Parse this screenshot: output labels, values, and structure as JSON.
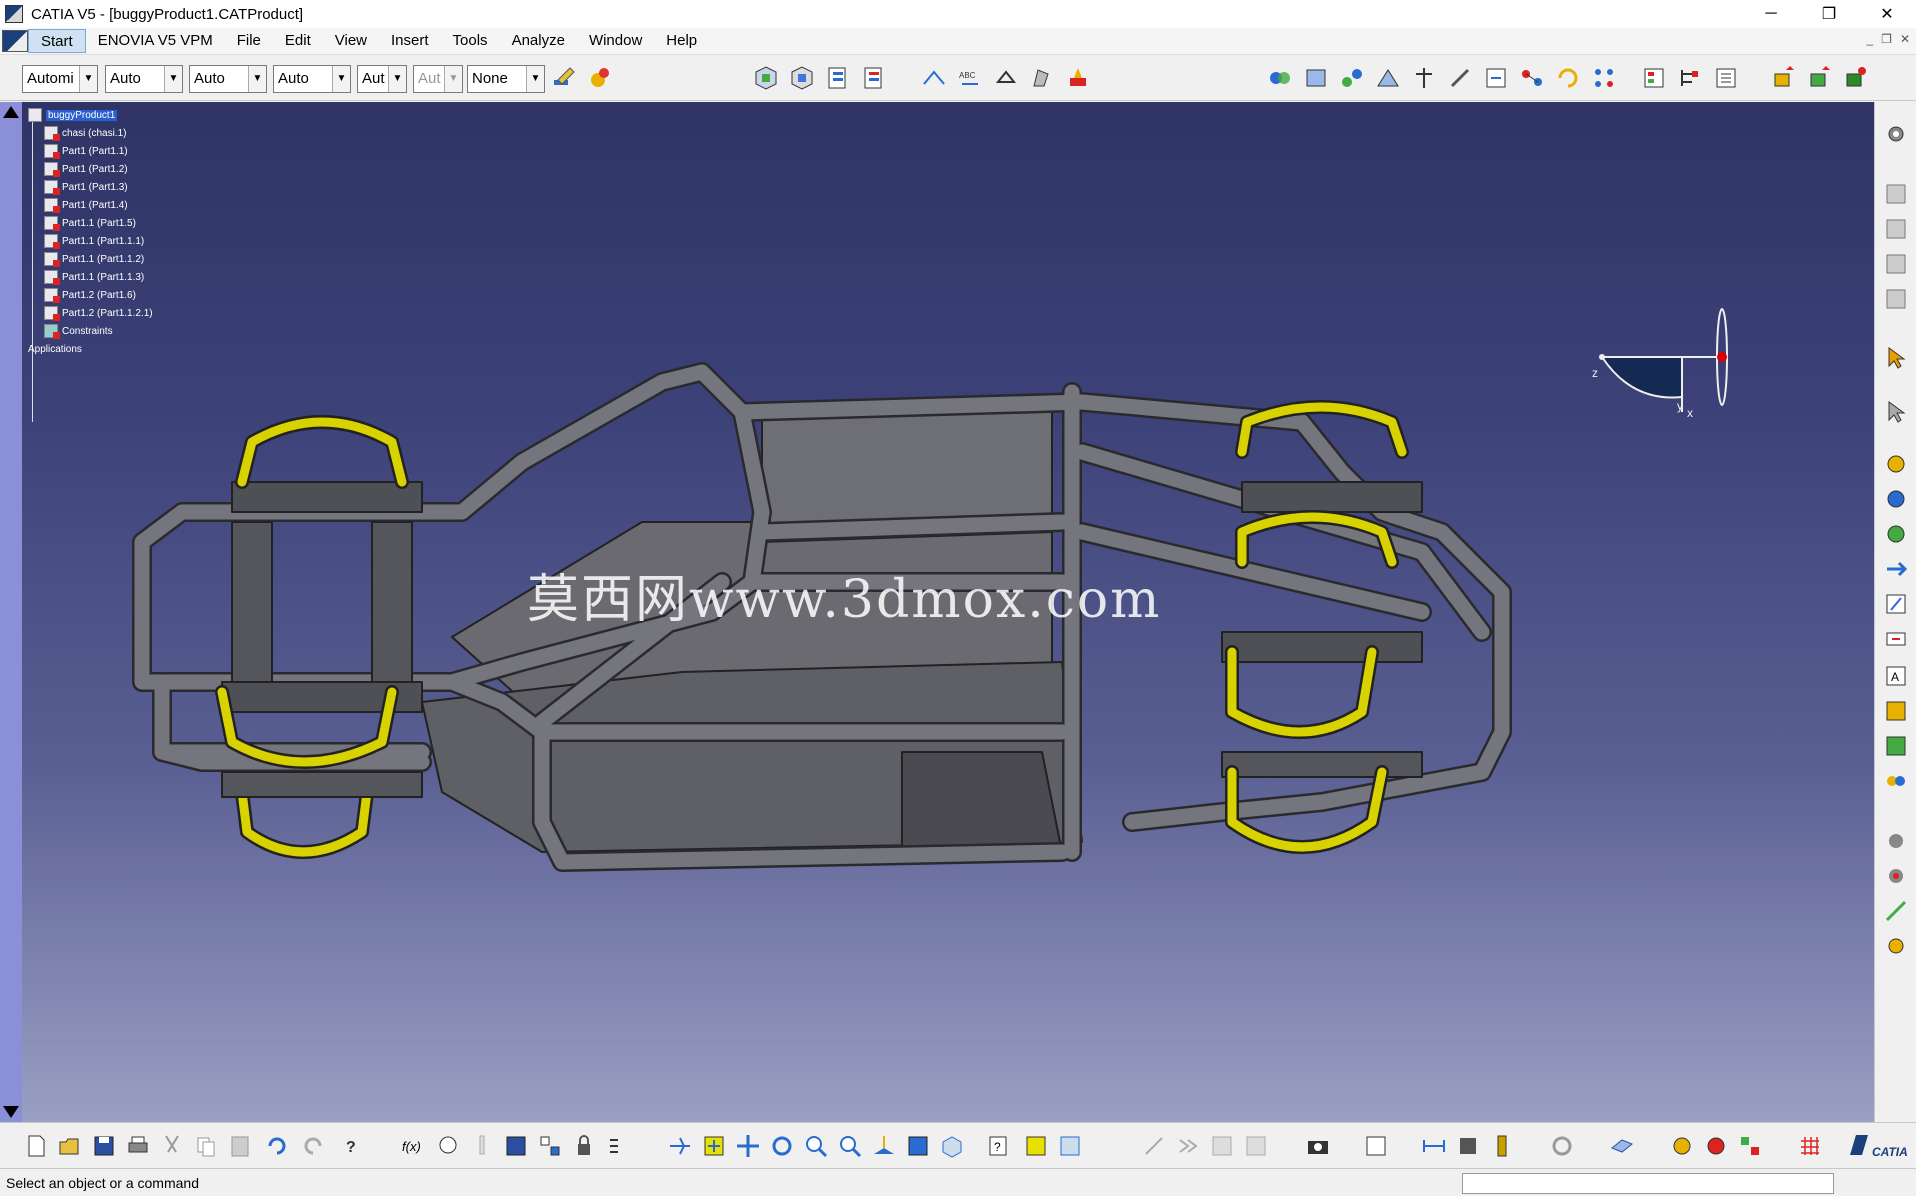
{
  "window": {
    "title": "CATIA V5 - [buggyProduct1.CATProduct]",
    "controls": [
      "─",
      "❐",
      "✕"
    ]
  },
  "menu": {
    "items": [
      "Start",
      "ENOVIA V5 VPM",
      "File",
      "Edit",
      "View",
      "Insert",
      "Tools",
      "Analyze",
      "Window",
      "Help"
    ],
    "mdi_controls": [
      "_",
      "❐",
      "✕"
    ]
  },
  "toolbar_top": {
    "combos": [
      {
        "value": "Automi",
        "enabled": true
      },
      {
        "value": "Auto",
        "enabled": true
      },
      {
        "value": "Auto",
        "enabled": true
      },
      {
        "value": "Auto",
        "enabled": true
      },
      {
        "value": "Aut",
        "enabled": true
      },
      {
        "value": "Aut",
        "enabled": false
      },
      {
        "value": "None",
        "enabled": true
      }
    ]
  },
  "tree": {
    "root": "buggyProduct1",
    "nodes": [
      "chasi (chasi.1)",
      "Part1 (Part1.1)",
      "Part1 (Part1.2)",
      "Part1 (Part1.3)",
      "Part1 (Part1.4)",
      "Part1.1 (Part1.5)",
      "Part1.1 (Part1.1.1)",
      "Part1.1 (Part1.1.2)",
      "Part1.1 (Part1.1.3)",
      "Part1.2 (Part1.6)",
      "Part1.2 (Part1.1.2.1)"
    ],
    "constraints": "Constraints",
    "applications": "Applications"
  },
  "viewport": {
    "watermark": "莫西网www.3dmox.com",
    "compass_axes": {
      "z": "z",
      "y": "y",
      "x": "x"
    },
    "corner_axes": {
      "z": "z",
      "x": "x"
    }
  },
  "status": {
    "message": "Select an object or a command"
  },
  "branding": {
    "logo_text": "CATIA"
  },
  "colors": {
    "viewport_top": "#2f3466",
    "viewport_bottom": "#9a9fc4",
    "frame": "#6b6b72",
    "yellow_parts": "#d8d200",
    "selection": "#2a5fd0"
  }
}
